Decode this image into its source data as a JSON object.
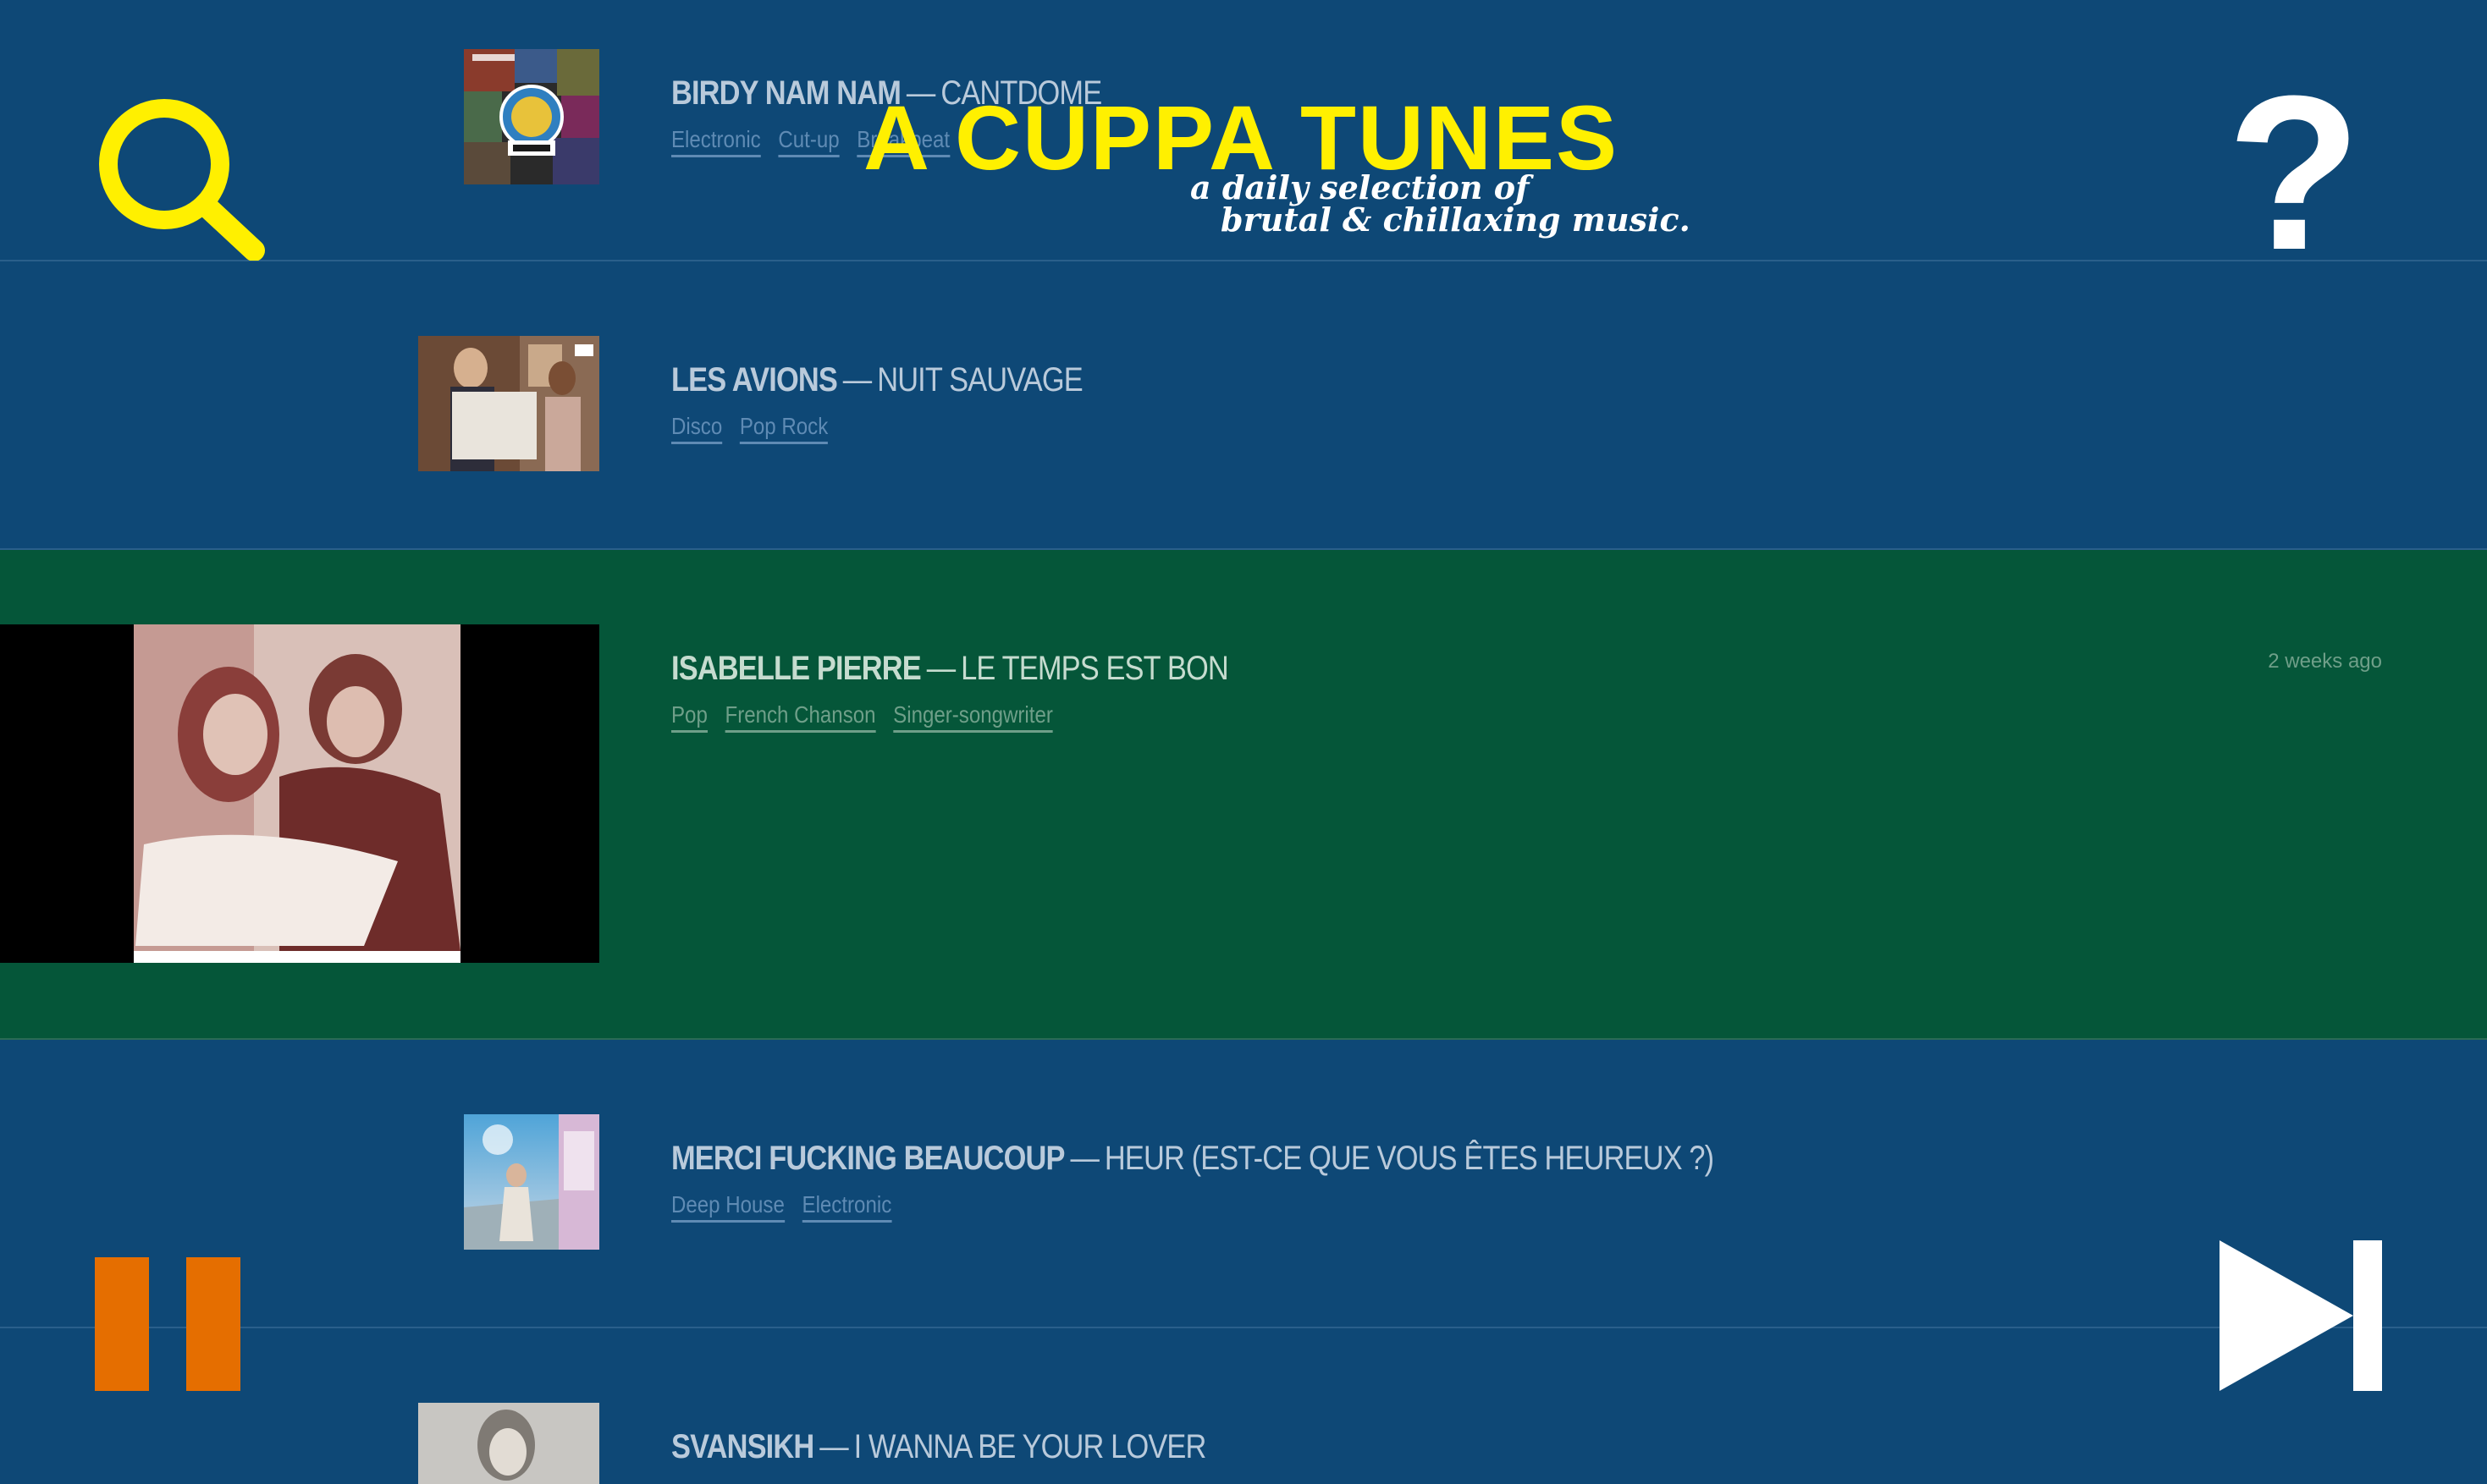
{
  "header": {
    "logo": "A CUPPA TUNES",
    "tagline_line1": "a daily selection of",
    "tagline_line2": "brutal & chillaxing music.",
    "help_label": "?"
  },
  "colors": {
    "background": "#0e4876",
    "playing_row": "#055639",
    "accent_yellow": "#fff000",
    "pause_orange": "#e56e00"
  },
  "player": {
    "state": "playing"
  },
  "tracks": [
    {
      "artist": "BIRDY NAM NAM",
      "sep": "—",
      "song": "CANTDOME",
      "tags": [
        "Electronic",
        "Cut-up",
        "Breakbeat"
      ]
    },
    {
      "artist": "LES AVIONS",
      "sep": "—",
      "song": "NUIT SAUVAGE",
      "tags": [
        "Disco",
        "Pop Rock"
      ]
    },
    {
      "artist": "ISABELLE PIERRE",
      "sep": "—",
      "song": "LE TEMPS EST BON",
      "tags": [
        "Pop",
        "French Chanson",
        "Singer-songwriter"
      ],
      "time_ago": "2 weeks ago"
    },
    {
      "artist": "MERCI FUCKING BEAUCOUP",
      "sep": "—",
      "song": "HEUR (EST-CE QUE VOUS ÊTES HEUREUX ?)",
      "tags": [
        "Deep House",
        "Electronic"
      ]
    },
    {
      "artist": "SVANSIKH",
      "sep": "—",
      "song": "I WANNA BE YOUR LOVER"
    }
  ]
}
